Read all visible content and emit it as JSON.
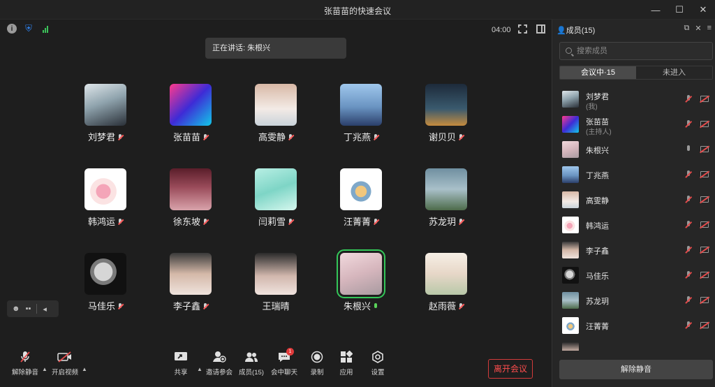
{
  "window": {
    "title": "张苗苗的快速会议",
    "controls": [
      "minimize-icon",
      "maximize-icon",
      "close-icon"
    ]
  },
  "stage": {
    "timer": "04:00",
    "speaking_label": "正在讲话: 朱根兴"
  },
  "participants_grid": [
    {
      "name": "刘梦君",
      "mic": "off"
    },
    {
      "name": "张苗苗",
      "mic": "off"
    },
    {
      "name": "高雯静",
      "mic": "off"
    },
    {
      "name": "丁兆燕",
      "mic": "off"
    },
    {
      "name": "谢贝贝",
      "mic": "off"
    },
    {
      "name": "韩鸿运",
      "mic": "off"
    },
    {
      "name": "徐东坡",
      "mic": "off"
    },
    {
      "name": "闫莉雪",
      "mic": "off"
    },
    {
      "name": "汪菁菁",
      "mic": "off"
    },
    {
      "name": "苏龙玥",
      "mic": "off"
    },
    {
      "name": "马佳乐",
      "mic": "off"
    },
    {
      "name": "李子鑫",
      "mic": "off"
    },
    {
      "name": "王瑞晴",
      "mic": "off"
    },
    {
      "name": "朱根兴",
      "mic": "on",
      "active": true
    },
    {
      "name": "赵雨薇",
      "mic": "off"
    }
  ],
  "toolbar": {
    "unmute": "解除静音",
    "start_video": "开启视频",
    "share": "共享",
    "invite": "邀请参会",
    "members": "成员(15)",
    "chat": "会中聊天",
    "chat_badge": "1",
    "record": "录制",
    "apps": "应用",
    "settings": "设置",
    "leave": "离开会议"
  },
  "panel": {
    "title": "成员(15)",
    "search_placeholder": "搜索成员",
    "tabs": [
      {
        "label": "会议中·15",
        "selected": true
      },
      {
        "label": "未进入",
        "selected": false
      }
    ],
    "members": [
      {
        "name": "刘梦君",
        "role": "(我)",
        "mic": "off"
      },
      {
        "name": "张苗苗",
        "role": "(主持人)",
        "mic": "off"
      },
      {
        "name": "朱根兴",
        "role": "",
        "mic": "on"
      },
      {
        "name": "丁兆燕",
        "role": "",
        "mic": "off"
      },
      {
        "name": "高雯静",
        "role": "",
        "mic": "off"
      },
      {
        "name": "韩鸿运",
        "role": "",
        "mic": "off"
      },
      {
        "name": "李子鑫",
        "role": "",
        "mic": "off"
      },
      {
        "name": "马佳乐",
        "role": "",
        "mic": "off"
      },
      {
        "name": "苏龙玥",
        "role": "",
        "mic": "off"
      },
      {
        "name": "汪菁菁",
        "role": "",
        "mic": "off"
      },
      {
        "name": "",
        "role": "",
        "mic": "off"
      }
    ],
    "unmute_all": "解除静音"
  },
  "colors": {
    "accent_green": "#34c759",
    "danger_red": "#e34b4b",
    "shield_blue": "#2f7fe8"
  }
}
